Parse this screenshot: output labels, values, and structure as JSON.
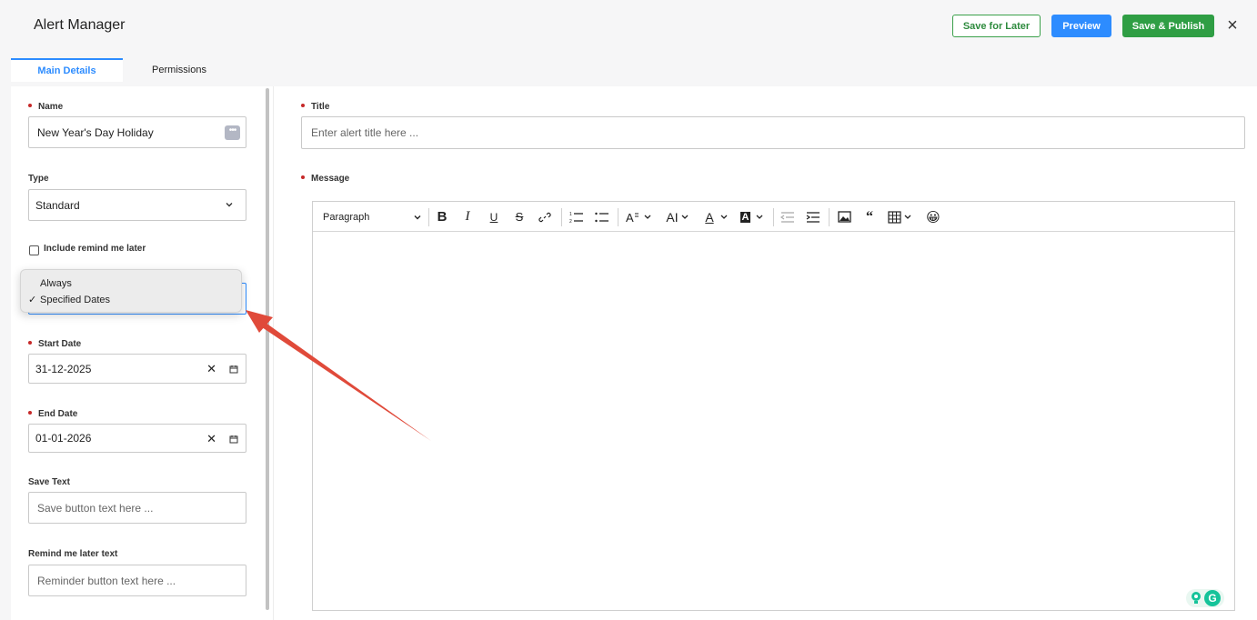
{
  "header": {
    "title": "Alert Manager",
    "save_later_label": "Save for Later",
    "preview_label": "Preview",
    "publish_label": "Save & Publish",
    "close_symbol": "×"
  },
  "tabs": [
    {
      "label": "Main Details",
      "active": true
    },
    {
      "label": "Permissions",
      "active": false
    }
  ],
  "form": {
    "name": {
      "label": "Name",
      "value": "New Year's Day Holiday",
      "required": true
    },
    "type": {
      "label": "Type",
      "value": "Standard"
    },
    "remind_checkbox": {
      "label": "Include remind me later",
      "checked": false
    },
    "schedule_dropdown": {
      "options": [
        "Always",
        "Specified Dates"
      ],
      "selected": "Specified Dates",
      "check_symbol": "✓"
    },
    "start_date": {
      "label": "Start Date",
      "value": "31-12-2025",
      "required": true
    },
    "end_date": {
      "label": "End Date",
      "value": "01-01-2026",
      "required": true
    },
    "save_text": {
      "label": "Save Text",
      "placeholder": "Save button text here ..."
    },
    "remind_text": {
      "label": "Remind me later text",
      "placeholder": "Reminder button text here ..."
    },
    "clear_symbol": "✕"
  },
  "right": {
    "title": {
      "label": "Title",
      "placeholder": "Enter alert title here ...",
      "required": true
    },
    "message": {
      "label": "Message",
      "required": true
    }
  },
  "toolbar": {
    "paragraph_label": "Paragraph",
    "bold": "B",
    "italic": "I",
    "underline": "U",
    "strike": "S",
    "font_size_icon": "AI",
    "font_color_icon": "A",
    "bg_color_icon": "A",
    "emoji": "😀"
  },
  "colors": {
    "accent": "#2d8cff",
    "success": "#2f9e44",
    "required": "#c62828",
    "arrow": "#e04a3a"
  }
}
